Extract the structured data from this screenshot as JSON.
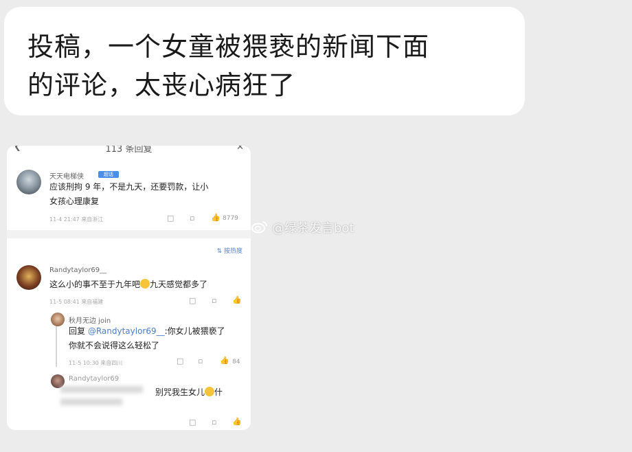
{
  "message": {
    "line1": "投稿，一个女童被猥亵的新闻下面",
    "line2": "的评论，太丧心病狂了"
  },
  "shot": {
    "header": {
      "title": "113 条回复"
    },
    "comment1": {
      "user": "天天电梯侠",
      "badge": "超话",
      "text1": "应该刑拘 9 年，不是九天，还要罚款，让小",
      "text2": "女孩心理康复",
      "meta": "11-4 21:47 来自浙江",
      "likes": "8779"
    },
    "sort_label": "按热度",
    "comment2": {
      "user": "Randytaylor69__",
      "text_before": "这么小的事不至于九年吧",
      "text_after": "九天感觉都多了",
      "meta": "11-5 08:41 来自福建"
    },
    "reply1": {
      "user": "秋月无边 join",
      "prefix": "回复 ",
      "mention": "@Randytaylor69__",
      "text_a": ":你女儿被猥亵了",
      "text_b": "你就不会说得这么轻松了",
      "meta": "11-5 10:30 来自四川",
      "likes": "84"
    },
    "reply2": {
      "user": "Randytaylor69",
      "text_before": "别咒我生女儿",
      "text_after": "什"
    }
  },
  "watermark": "@绿茶发言bot",
  "colors": {
    "background": "#ececec",
    "bubble": "#ffffff",
    "link": "#4a7fc8"
  }
}
